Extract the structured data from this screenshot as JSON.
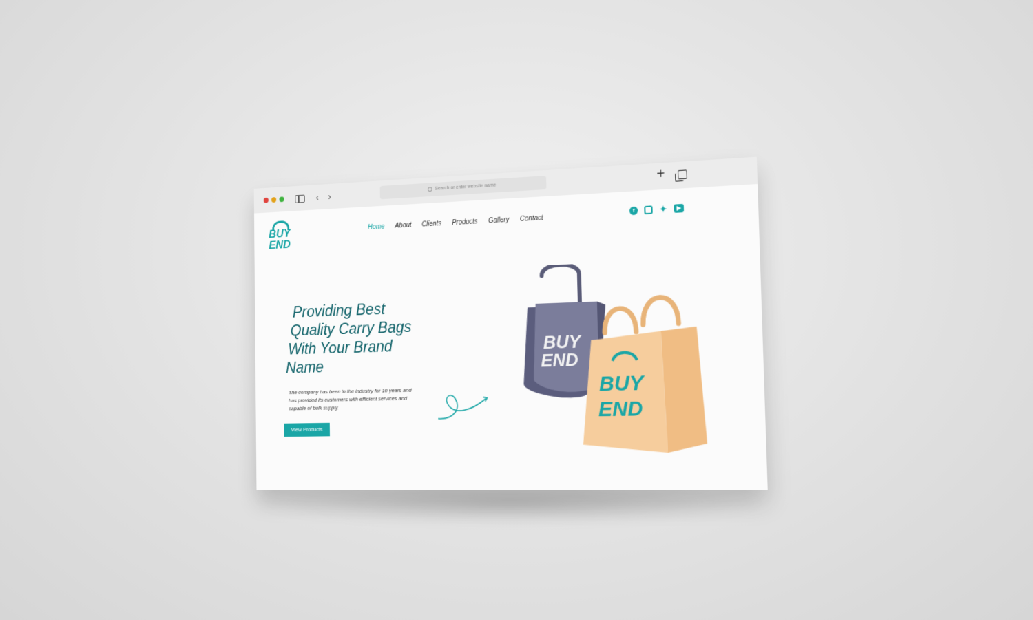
{
  "browser": {
    "address_placeholder": "Search or enter website name"
  },
  "logo": {
    "line1": "BUY",
    "line2": "END"
  },
  "nav": {
    "items": [
      {
        "label": "Home",
        "active": true
      },
      {
        "label": "About",
        "active": false
      },
      {
        "label": "Clients",
        "active": false
      },
      {
        "label": "Products",
        "active": false
      },
      {
        "label": "Gallery",
        "active": false
      },
      {
        "label": "Contact",
        "active": false
      }
    ]
  },
  "social": {
    "icons": [
      "facebook-icon",
      "instagram-icon",
      "twitter-icon",
      "youtube-icon"
    ]
  },
  "hero": {
    "title_lines": [
      "Providing Best",
      "Quality Carry Bags",
      "With Your Brand",
      "Name"
    ],
    "text": "The company has been in the industry for 10 years and has provided its customers with efficient services and capable of bulk supply.",
    "cta_label": "View Products"
  },
  "bags": {
    "left_bag_text": [
      "BUY",
      "END"
    ],
    "right_bag_text": [
      "BUY",
      "END"
    ]
  },
  "colors": {
    "accent": "#1aa6a6",
    "heading": "#12636a",
    "bag_dark": "#6a6d8c",
    "bag_light": "#f3c58f"
  }
}
